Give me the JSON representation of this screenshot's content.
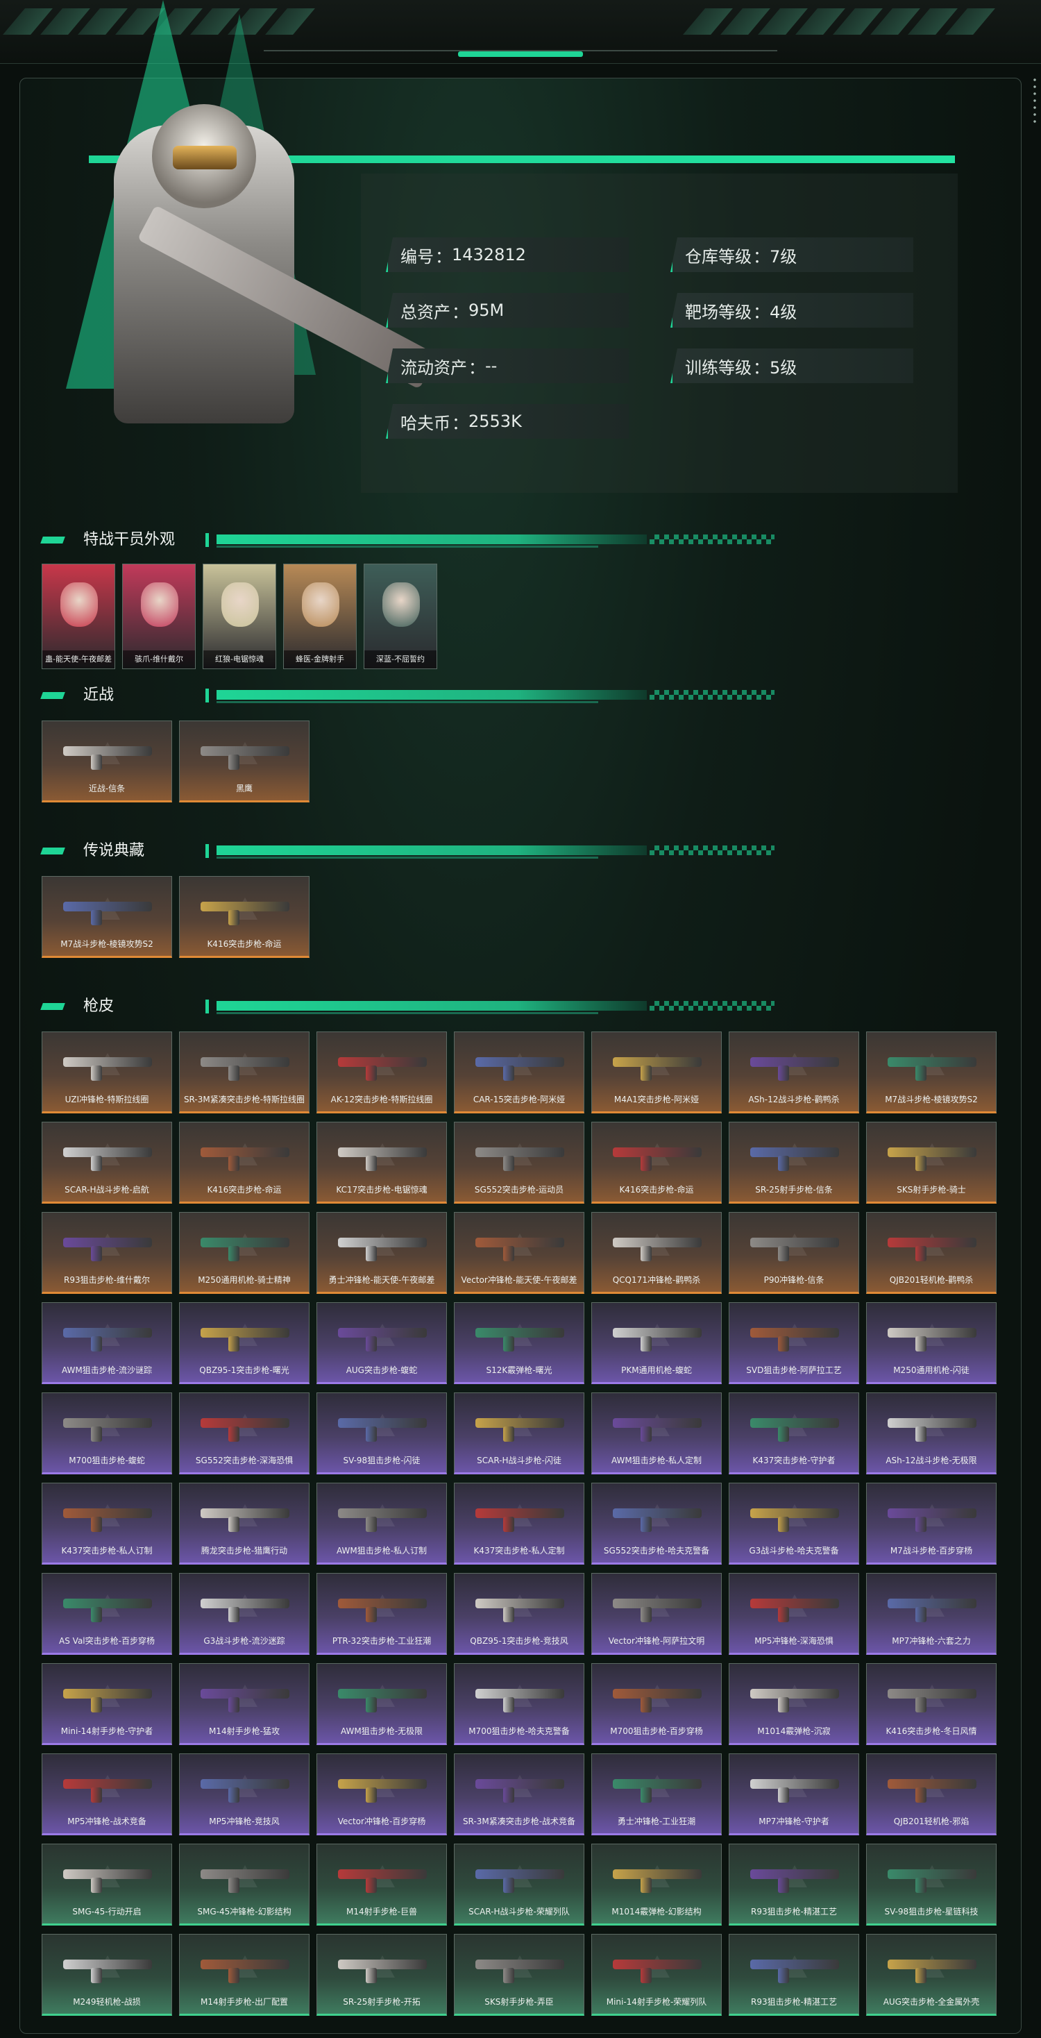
{
  "stats": [
    {
      "label": "编号",
      "value": "1432812"
    },
    {
      "label": "仓库等级",
      "value": "7级"
    },
    {
      "label": "总资产",
      "value": "95M"
    },
    {
      "label": "靶场等级",
      "value": "4级"
    },
    {
      "label": "流动资产",
      "value": "--"
    },
    {
      "label": "训练等级",
      "value": "5级"
    },
    {
      "label": "哈夫币",
      "value": "2553K"
    }
  ],
  "sections": {
    "agents": "特战干员外观",
    "melee": "近战",
    "legend": "传说典藏",
    "skins": "枪皮"
  },
  "agents": [
    {
      "name": "蛊-能天使-午夜邮差",
      "color": "#c8374a"
    },
    {
      "name": "骇爪-维什戴尔",
      "color": "#c23a5a"
    },
    {
      "name": "红狼-电锯惊魂",
      "color": "#c9c39a"
    },
    {
      "name": "蜂医-金牌射手",
      "color": "#b88a56"
    },
    {
      "name": "深蓝-不屈誓约",
      "color": "#3e5e58"
    }
  ],
  "melee": [
    {
      "name": "近战-信条",
      "tier": "orange"
    },
    {
      "name": "黑鹰",
      "tier": "orange"
    }
  ],
  "legend": [
    {
      "name": "M7战斗步枪-棱镜攻势S2",
      "tier": "orange"
    },
    {
      "name": "K416突击步枪-命运",
      "tier": "orange"
    }
  ],
  "skins": [
    [
      "UZI冲锋枪-特斯拉线圈",
      "SR-3M紧凑突击步枪-特斯拉线圈",
      "AK-12突击步枪-特斯拉线圈",
      "CAR-15突击步枪-阿米娅",
      "M4A1突击步枪-阿米娅",
      "ASh-12战斗步枪-鹳鸭杀",
      "M7战斗步枪-棱镜攻势S2"
    ],
    [
      "SCAR-H战斗步枪-启航",
      "K416突击步枪-命运",
      "KC17突击步枪-电锯惊魂",
      "SG552突击步枪-运动员",
      "K416突击步枪-命运",
      "SR-25射手步枪-信条",
      "SKS射手步枪-骑士"
    ],
    [
      "R93狙击步枪-维什戴尔",
      "M250通用机枪-骑士精神",
      "勇士冲锋枪-能天使-午夜邮差",
      "Vector冲锋枪-能天使-午夜邮差",
      "QCQ171冲锋枪-鹳鸭杀",
      "P90冲锋枪-信条",
      "QJB201轻机枪-鹳鸭杀"
    ],
    [
      "AWM狙击步枪-流沙谜踪",
      "QBZ95-1突击步枪-曙光",
      "AUG突击步枪-蝮蛇",
      "S12K霰弹枪-曙光",
      "PKM通用机枪-蝮蛇",
      "SVD狙击步枪-阿萨拉工艺",
      "M250通用机枪-闪徒"
    ],
    [
      "M700狙击步枪-蝮蛇",
      "SG552突击步枪-深海恐惧",
      "SV-98狙击步枪-闪徒",
      "SCAR-H战斗步枪-闪徒",
      "AWM狙击步枪-私人定制",
      "K437突击步枪-守护者",
      "ASh-12战斗步枪-无极限"
    ],
    [
      "K437突击步枪-私人订制",
      "腾龙突击步枪-猎鹰行动",
      "AWM狙击步枪-私人订制",
      "K437突击步枪-私人定制",
      "SG552突击步枪-哈夫克警备",
      "G3战斗步枪-哈夫克警备",
      "M7战斗步枪-百步穿杨"
    ],
    [
      "AS Val突击步枪-百步穿杨",
      "G3战斗步枪-流沙迷踪",
      "PTR-32突击步枪-工业狂潮",
      "QBZ95-1突击步枪-竞技风",
      "Vector冲锋枪-阿萨拉文明",
      "MP5冲锋枪-深海恐惧",
      "MP7冲锋枪-六套之力"
    ],
    [
      "Mini-14射手步枪-守护者",
      "M14射手步枪-猛攻",
      "AWM狙击步枪-无极限",
      "M700狙击步枪-哈夫克警备",
      "M700狙击步枪-百步穿杨",
      "M1014霰弹枪-沉寂",
      "K416突击步枪-冬日风情"
    ],
    [
      "MP5冲锋枪-战术竞备",
      "MP5冲锋枪-竞技风",
      "Vector冲锋枪-百步穿杨",
      "SR-3M紧凑突击步枪-战术竞备",
      "勇士冲锋枪-工业狂潮",
      "MP7冲锋枪-守护者",
      "QJB201轻机枪-邪焰"
    ],
    [
      "SMG-45-行动开启",
      "SMG-45冲锋枪-幻影结构",
      "M14射手步枪-巨兽",
      "SCAR-H战斗步枪-荣耀列队",
      "M1014霰弹枪-幻影结构",
      "R93狙击步枪-精湛工艺",
      "SV-98狙击步枪-星链科技"
    ],
    [
      "M249轻机枪-战损",
      "M14射手步枪-出厂配置",
      "SR-25射手步枪-开拓",
      "SKS射手步枪-弄臣",
      "Mini-14射手步枪-荣耀列队",
      "R93狙击步枪-精湛工艺",
      "AUG突击步枪-全金属外壳"
    ]
  ],
  "skin_row_tiers": [
    "orange",
    "orange",
    "orange",
    "purple",
    "purple",
    "purple",
    "purple",
    "purple",
    "purple",
    "green",
    "green"
  ],
  "colors": {
    "accent": "#1fd596",
    "orange": "#e08a36",
    "purple": "#9b7ae6",
    "green": "#3fd18e"
  }
}
